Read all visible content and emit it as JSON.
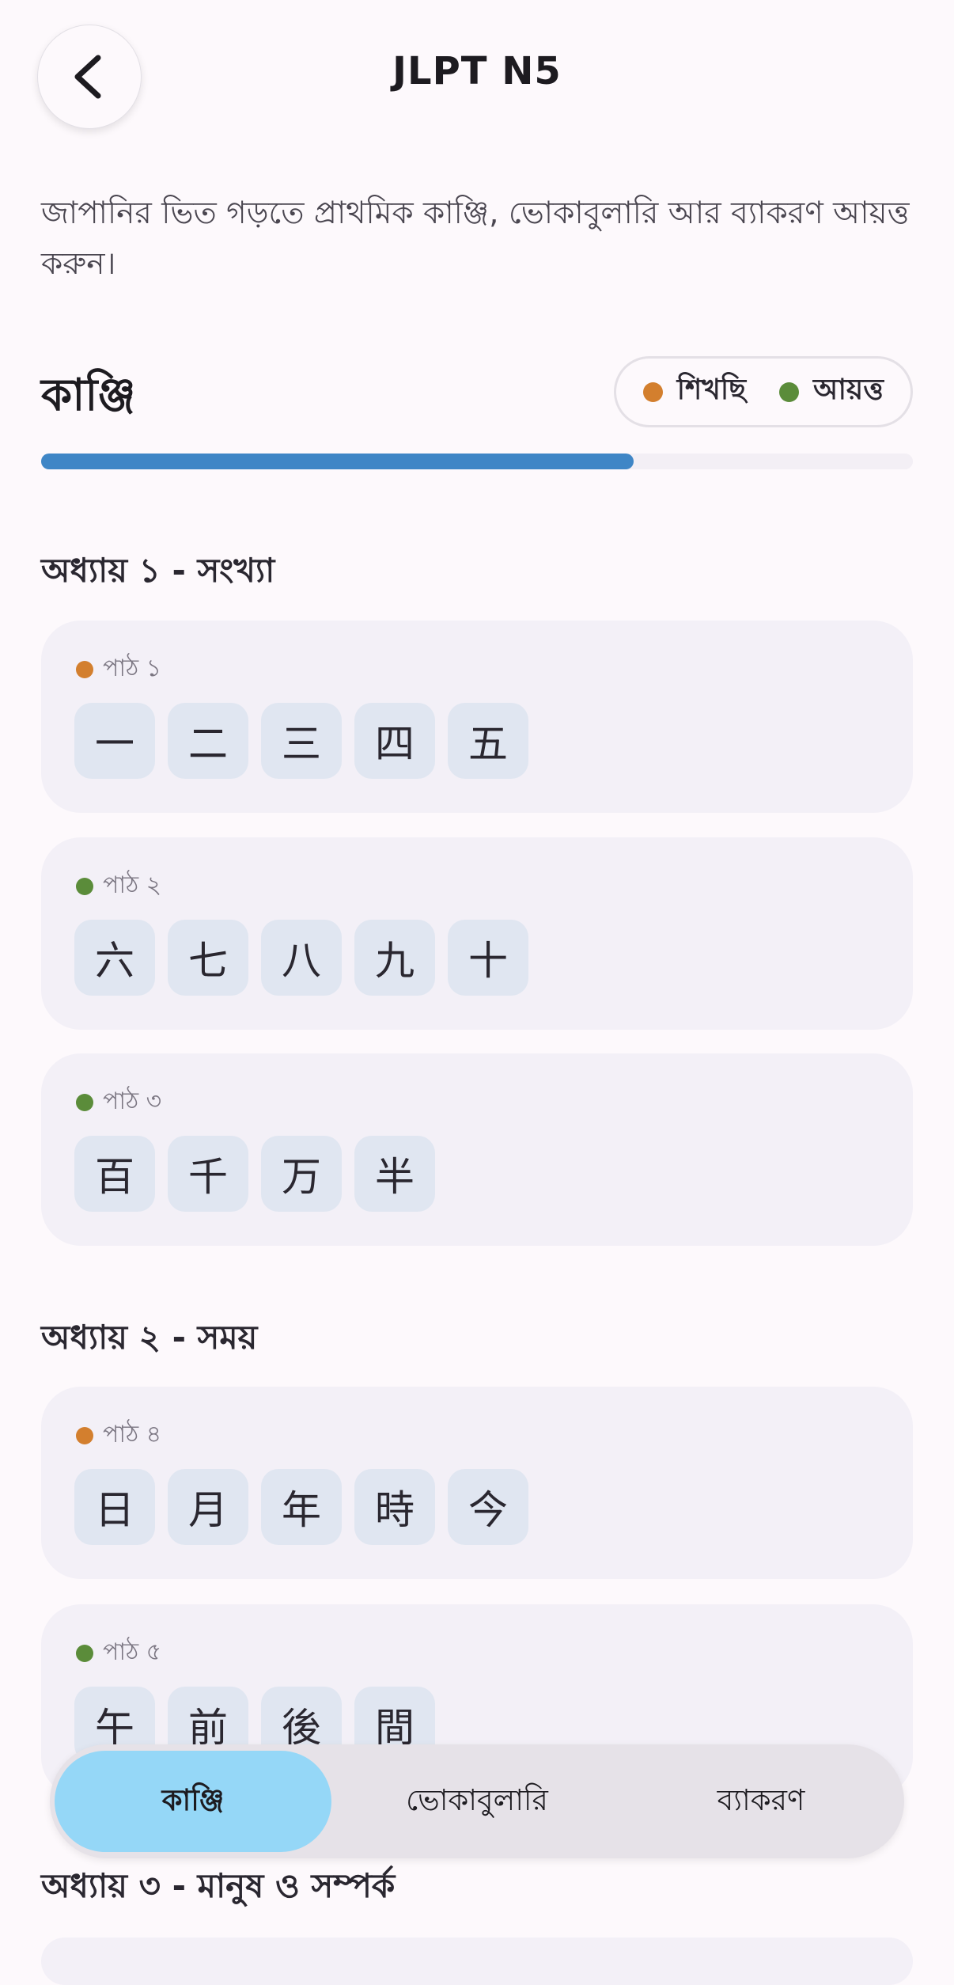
{
  "header": {
    "title": "JLPT N5",
    "back_label": "back"
  },
  "description": "জাপানির ভিত গড়তে প্রাথমিক কাঞ্জি, ভোকাবুলারি আর ব্যাকরণ আয়ত্ত করুন।",
  "section": {
    "title": "কাঞ্জি",
    "progress_fraction": 0.68
  },
  "legend": {
    "learning": {
      "label": "শিখছি",
      "color": "#d37f2e"
    },
    "mastered": {
      "label": "আয়ত্ত",
      "color": "#5b8c3a"
    }
  },
  "chapters": [
    {
      "title": "অধ্যায় ১ - সংখ্যা"
    },
    {
      "title": "অধ্যায় ২ - সময়"
    },
    {
      "title": "অধ্যায় ৩ - মানুষ ও সম্পর্ক"
    }
  ],
  "lessons": [
    {
      "label": "পাঠ ১",
      "status": "learning",
      "kanji": [
        "一",
        "二",
        "三",
        "四",
        "五"
      ]
    },
    {
      "label": "পাঠ ২",
      "status": "mastered",
      "kanji": [
        "六",
        "七",
        "八",
        "九",
        "十"
      ]
    },
    {
      "label": "পাঠ ৩",
      "status": "mastered",
      "kanji": [
        "百",
        "千",
        "万",
        "半"
      ]
    },
    {
      "label": "পাঠ ৪",
      "status": "learning",
      "kanji": [
        "日",
        "月",
        "年",
        "時",
        "今"
      ]
    },
    {
      "label": "পাঠ ৫",
      "status": "mastered",
      "kanji": [
        "午",
        "前",
        "後",
        "間"
      ]
    }
  ],
  "tabs": [
    {
      "label": "কাঞ্জি",
      "active": true
    },
    {
      "label": "ভোকাবুলারি",
      "active": false
    },
    {
      "label": "ব্যাকরণ",
      "active": false
    }
  ]
}
